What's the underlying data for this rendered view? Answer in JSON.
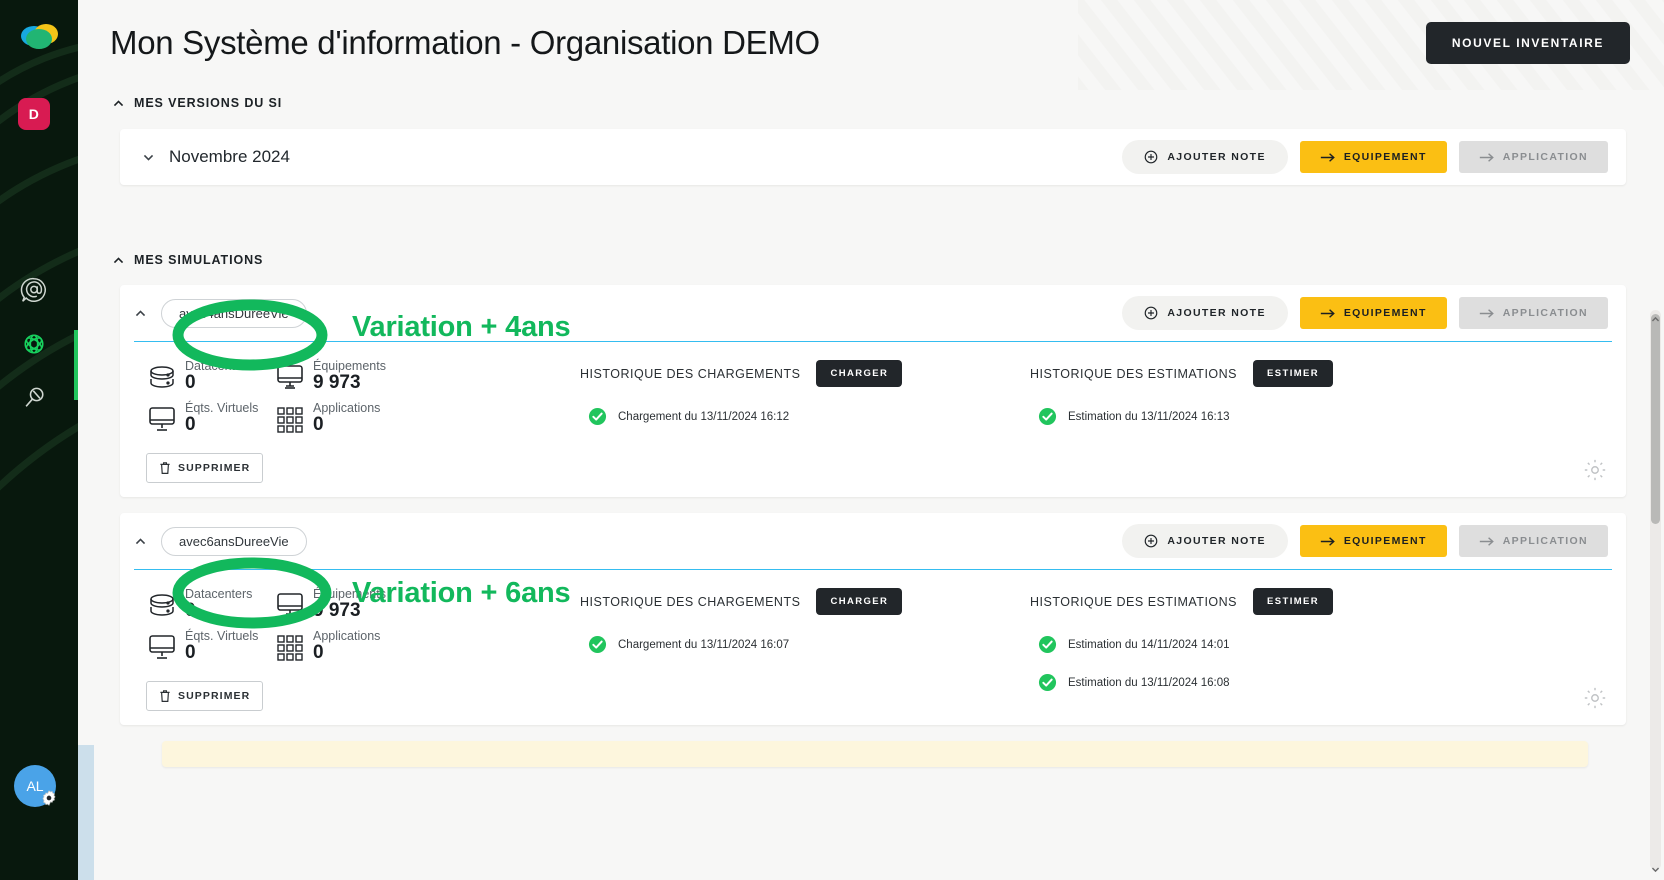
{
  "sidebar": {
    "logo_name": "app-logo",
    "org_badge": "D",
    "icons": [
      {
        "name": "mention-icon",
        "glyph": "@"
      },
      {
        "name": "globe-icon",
        "glyph": "globe"
      },
      {
        "name": "microphone-icon",
        "glyph": "mic"
      }
    ],
    "avatar_initials": "AL",
    "settings_icon": "gear-icon"
  },
  "header": {
    "title": "Mon Système d'information - Organisation DEMO",
    "new_inventory_label": "NOUVEL INVENTAIRE"
  },
  "sections": {
    "versions_label": "MES VERSIONS DU SI",
    "simulations_label": "MES SIMULATIONS"
  },
  "version_row": {
    "label": "Novembre 2024",
    "add_note_label": "AJOUTER NOTE",
    "equipment_label": "EQUIPEMENT",
    "application_label": "APPLICATION"
  },
  "buttons": {
    "add_note_label": "AJOUTER NOTE",
    "equipment_label": "EQUIPEMENT",
    "application_label": "APPLICATION",
    "delete_label": "SUPPRIMER",
    "load_label": "CHARGER",
    "estimate_label": "ESTIMER"
  },
  "history_titles": {
    "loads": "HISTORIQUE DES CHARGEMENTS",
    "estimations": "HISTORIQUE DES ESTIMATIONS"
  },
  "stat_labels": {
    "datacenters": "Datacenters",
    "equipments": "Équipements",
    "virtual": "Éqts. Virtuels",
    "applications": "Applications"
  },
  "simulations": [
    {
      "name": "avec4ansDureeVie",
      "stats": {
        "datacenters": "0",
        "equipments": "9 973",
        "virtual": "0",
        "applications": "0"
      },
      "loads": [
        "Chargement du 13/11/2024 16:12"
      ],
      "estimations": [
        "Estimation du 13/11/2024 16:13"
      ]
    },
    {
      "name": "avec6ansDureeVie",
      "stats": {
        "datacenters": "0",
        "equipments": "9 973",
        "virtual": "0",
        "applications": "0"
      },
      "loads": [
        "Chargement du 13/11/2024 16:07"
      ],
      "estimations": [
        "Estimation du 14/11/2024 14:01",
        "Estimation du 13/11/2024 16:08"
      ]
    }
  ],
  "annotations": [
    {
      "text": "Variation + 4ans",
      "target": "avec4ansDureeVie"
    },
    {
      "text": "Variation + 6ans",
      "target": "avec6ansDureeVie"
    }
  ],
  "colors": {
    "accent_yellow": "#fbbf13",
    "annotation_green": "#12b85c",
    "sidebar_dark": "#08180d",
    "badge_red": "#d81b52",
    "avatar_blue": "#4aa3e8",
    "rule_blue": "#35bdf0"
  }
}
